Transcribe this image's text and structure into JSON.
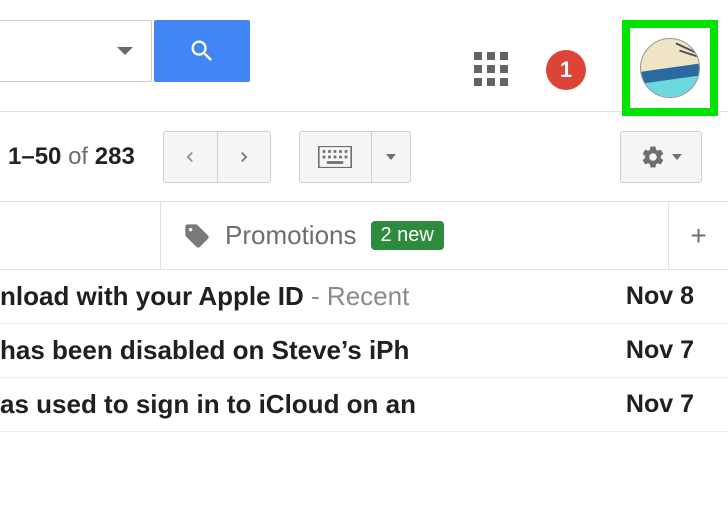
{
  "topbar": {
    "notification_count": "1"
  },
  "toolbar": {
    "page_range": "1–50",
    "page_of_word": "of",
    "page_total": "283"
  },
  "tabs": {
    "promotions_label": "Promotions",
    "promotions_badge": "2 new",
    "add_label": "+"
  },
  "messages": [
    {
      "subject_visible": "nload with your Apple ID",
      "suffix": " - Recent",
      "date": "Nov 8"
    },
    {
      "subject_visible": "has been disabled on Steve’s iPh",
      "suffix": "",
      "date": "Nov 7"
    },
    {
      "subject_visible": "as used to sign in to iCloud on an",
      "suffix": "",
      "date": "Nov 7"
    }
  ]
}
